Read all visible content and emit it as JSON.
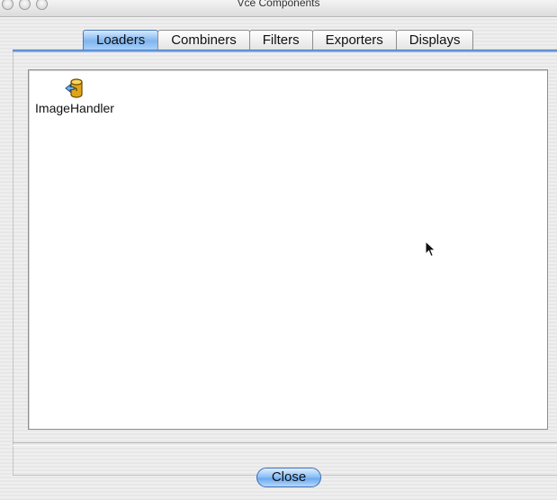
{
  "window": {
    "title": "Vce Components"
  },
  "tabs": [
    {
      "label": "Loaders",
      "selected": true
    },
    {
      "label": "Combiners",
      "selected": false
    },
    {
      "label": "Filters",
      "selected": false
    },
    {
      "label": "Exporters",
      "selected": false
    },
    {
      "label": "Displays",
      "selected": false
    }
  ],
  "components": [
    {
      "label": "ImageHandler",
      "icon": "database-loader-icon"
    }
  ],
  "footer": {
    "close_label": "Close"
  },
  "colors": {
    "accent": "#6aa8ee",
    "tab_rule": "#3e77c9"
  }
}
